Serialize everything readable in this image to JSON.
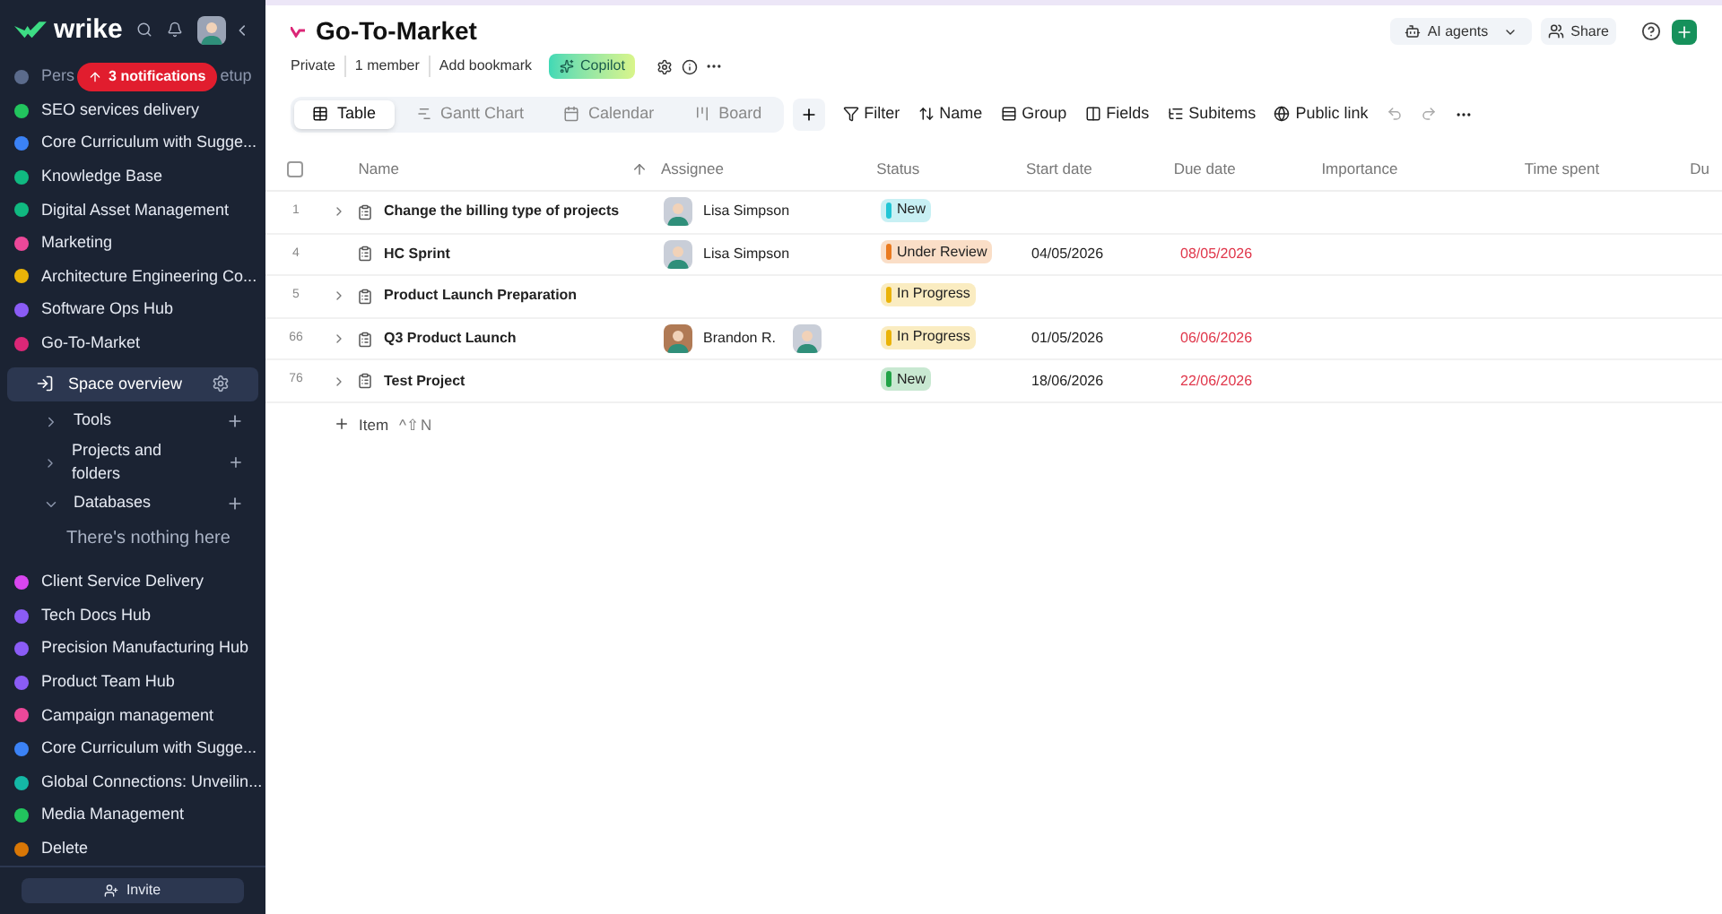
{
  "sidebar": {
    "logo": "wrike",
    "notification_badge": "3 notifications",
    "spaces_top": [
      {
        "label_start": "Pers",
        "label_end": "etup",
        "color": "#5b6b8c"
      },
      {
        "label": "SEO services delivery",
        "color": "#22c55e"
      },
      {
        "label": "Core Curriculum with Sugge...",
        "color": "#3b82f6"
      },
      {
        "label": "Knowledge Base",
        "color": "#10b981"
      },
      {
        "label": "Digital Asset Management",
        "color": "#10b981"
      },
      {
        "label": "Marketing",
        "color": "#ec4899"
      },
      {
        "label": "Architecture Engineering Co...",
        "color": "#eab308"
      },
      {
        "label": "Software Ops Hub",
        "color": "#8b5cf6"
      },
      {
        "label": "Go-To-Market",
        "color": "#db2777"
      }
    ],
    "space_overview": {
      "label": "Space overview",
      "selected": true
    },
    "sections": [
      {
        "label": "Tools",
        "expanded": false
      },
      {
        "label": "Projects and folders",
        "expanded": false
      },
      {
        "label": "Databases",
        "expanded": true,
        "empty_text": "There's nothing here"
      }
    ],
    "spaces_bottom": [
      {
        "label": "Client Service Delivery",
        "color": "#d946ef"
      },
      {
        "label": "Tech Docs Hub",
        "color": "#8b5cf6"
      },
      {
        "label": "Precision Manufacturing Hub",
        "color": "#8b5cf6"
      },
      {
        "label": "Product Team Hub",
        "color": "#8b5cf6"
      },
      {
        "label": "Campaign management",
        "color": "#ec4899"
      },
      {
        "label": "Core Curriculum with Sugge...",
        "color": "#3b82f6"
      },
      {
        "label": "Global Connections: Unveilin...",
        "color": "#14b8a6"
      },
      {
        "label": "Media Management",
        "color": "#22c55e"
      },
      {
        "label": "Delete",
        "color": "#d97706"
      }
    ],
    "invite": "Invite"
  },
  "header": {
    "title": "Go-To-Market",
    "meta": [
      "Private",
      "1 member",
      "Add bookmark"
    ],
    "copilot": "Copilot",
    "ai_agents": "AI agents",
    "share": "Share"
  },
  "views": [
    {
      "label": "Table",
      "selected": true
    },
    {
      "label": "Gantt Chart",
      "selected": false
    },
    {
      "label": "Calendar",
      "selected": false
    },
    {
      "label": "Board",
      "selected": false
    }
  ],
  "toolbar": [
    "Filter",
    "Name",
    "Group",
    "Fields",
    "Subitems",
    "Public link"
  ],
  "table": {
    "columns": [
      "Name",
      "Assignee",
      "Status",
      "Start date",
      "Due date",
      "Importance",
      "Time spent",
      "Du"
    ],
    "rows": [
      {
        "id": "1",
        "expandable": true,
        "name": "Change the billing type of projects",
        "assignee": "Lisa Simpson",
        "extra_avatar": false,
        "status": "New",
        "color": "#22c5d5",
        "start": "",
        "due": ""
      },
      {
        "id": "4",
        "expandable": false,
        "name": "HC Sprint",
        "assignee": "Lisa Simpson",
        "extra_avatar": false,
        "status": "Under Review",
        "color": "#ea7a1f",
        "start": "04/05/2026",
        "due": "08/05/2026"
      },
      {
        "id": "5",
        "expandable": true,
        "name": "Product Launch Preparation",
        "assignee": "",
        "extra_avatar": false,
        "status": "In Progress",
        "color": "#eab308",
        "start": "",
        "due": ""
      },
      {
        "id": "66",
        "expandable": true,
        "name": "Q3 Product Launch",
        "assignee": "Brandon R.",
        "extra_avatar": true,
        "status": "In Progress",
        "color": "#eab308",
        "start": "01/05/2026",
        "due": "06/06/2026"
      },
      {
        "id": "76",
        "expandable": true,
        "name": "Test Project",
        "assignee": "",
        "extra_avatar": false,
        "status": "New",
        "color": "#22a347",
        "start": "18/06/2026",
        "due": "22/06/2026"
      }
    ],
    "select_all_checked": false,
    "add_item": "Item",
    "shortcut": "^⇧N"
  }
}
